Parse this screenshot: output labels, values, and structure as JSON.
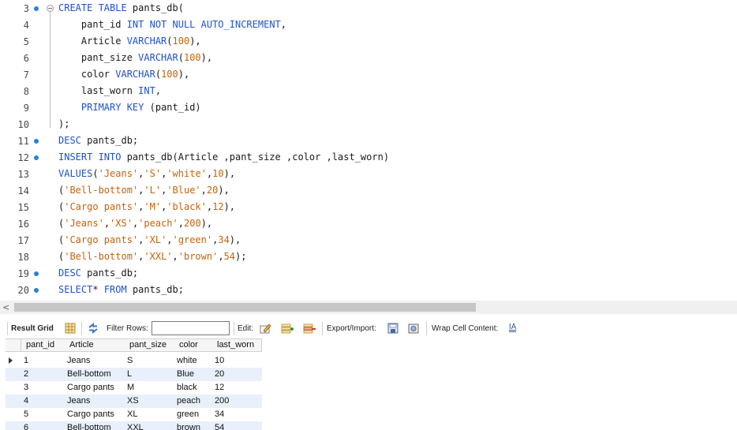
{
  "editor": {
    "lines": [
      {
        "num": "3",
        "marker": "fold",
        "tokens": [
          [
            "kw",
            "CREATE TABLE "
          ],
          [
            "t",
            "pants_db("
          ]
        ]
      },
      {
        "num": "4",
        "marker": "none",
        "tokens": [
          [
            "t",
            "    pant_id "
          ],
          [
            "kw",
            "INT NOT NULL AUTO_INCREMENT"
          ],
          [
            "t",
            ","
          ]
        ]
      },
      {
        "num": "5",
        "marker": "none",
        "tokens": [
          [
            "t",
            "    Article "
          ],
          [
            "kw",
            "VARCHAR"
          ],
          [
            "t",
            "("
          ],
          [
            "num",
            "100"
          ],
          [
            "t",
            "),"
          ]
        ]
      },
      {
        "num": "6",
        "marker": "none",
        "tokens": [
          [
            "t",
            "    pant_size "
          ],
          [
            "kw",
            "VARCHAR"
          ],
          [
            "t",
            "("
          ],
          [
            "num",
            "100"
          ],
          [
            "t",
            "),"
          ]
        ]
      },
      {
        "num": "7",
        "marker": "none",
        "tokens": [
          [
            "t",
            "    color "
          ],
          [
            "kw",
            "VARCHAR"
          ],
          [
            "t",
            "("
          ],
          [
            "num",
            "100"
          ],
          [
            "t",
            "),"
          ]
        ]
      },
      {
        "num": "8",
        "marker": "none",
        "tokens": [
          [
            "t",
            "    last_worn "
          ],
          [
            "kw",
            "INT"
          ],
          [
            "t",
            ","
          ]
        ]
      },
      {
        "num": "9",
        "marker": "none",
        "tokens": [
          [
            "t",
            "    "
          ],
          [
            "kw",
            "PRIMARY KEY"
          ],
          [
            "t",
            " (pant_id)"
          ]
        ]
      },
      {
        "num": "10",
        "marker": "none",
        "tokens": [
          [
            "t",
            ");"
          ]
        ]
      },
      {
        "num": "11",
        "marker": "dot",
        "tokens": [
          [
            "kw",
            "DESC"
          ],
          [
            "t",
            " pants_db;"
          ]
        ]
      },
      {
        "num": "12",
        "marker": "dot",
        "tokens": [
          [
            "kw",
            "INSERT INTO"
          ],
          [
            "t",
            " pants_db(Article ,pant_size ,color ,last_worn)"
          ]
        ]
      },
      {
        "num": "13",
        "marker": "none",
        "tokens": [
          [
            "kw",
            "VALUES"
          ],
          [
            "t",
            "("
          ],
          [
            "str",
            "'Jeans'"
          ],
          [
            "t",
            ","
          ],
          [
            "str",
            "'S'"
          ],
          [
            "t",
            ","
          ],
          [
            "str",
            "'white'"
          ],
          [
            "t",
            ","
          ],
          [
            "num",
            "10"
          ],
          [
            "t",
            "),"
          ]
        ]
      },
      {
        "num": "14",
        "marker": "none",
        "tokens": [
          [
            "t",
            "("
          ],
          [
            "str",
            "'Bell-bottom'"
          ],
          [
            "t",
            ","
          ],
          [
            "str",
            "'L'"
          ],
          [
            "t",
            ","
          ],
          [
            "str",
            "'Blue'"
          ],
          [
            "t",
            ","
          ],
          [
            "num",
            "20"
          ],
          [
            "t",
            "),"
          ]
        ]
      },
      {
        "num": "15",
        "marker": "none",
        "tokens": [
          [
            "t",
            "("
          ],
          [
            "str",
            "'Cargo pants'"
          ],
          [
            "t",
            ","
          ],
          [
            "str",
            "'M'"
          ],
          [
            "t",
            ","
          ],
          [
            "str",
            "'black'"
          ],
          [
            "t",
            ","
          ],
          [
            "num",
            "12"
          ],
          [
            "t",
            "),"
          ]
        ]
      },
      {
        "num": "16",
        "marker": "none",
        "tokens": [
          [
            "t",
            "("
          ],
          [
            "str",
            "'Jeans'"
          ],
          [
            "t",
            ","
          ],
          [
            "str",
            "'XS'"
          ],
          [
            "t",
            ","
          ],
          [
            "str",
            "'peach'"
          ],
          [
            "t",
            ","
          ],
          [
            "num",
            "200"
          ],
          [
            "t",
            "),"
          ]
        ]
      },
      {
        "num": "17",
        "marker": "none",
        "tokens": [
          [
            "t",
            "("
          ],
          [
            "str",
            "'Cargo pants'"
          ],
          [
            "t",
            ","
          ],
          [
            "str",
            "'XL'"
          ],
          [
            "t",
            ","
          ],
          [
            "str",
            "'green'"
          ],
          [
            "t",
            ","
          ],
          [
            "num",
            "34"
          ],
          [
            "t",
            "),"
          ]
        ]
      },
      {
        "num": "18",
        "marker": "none",
        "tokens": [
          [
            "t",
            "("
          ],
          [
            "str",
            "'Bell-bottom'"
          ],
          [
            "t",
            ","
          ],
          [
            "str",
            "'XXL'"
          ],
          [
            "t",
            ","
          ],
          [
            "str",
            "'brown'"
          ],
          [
            "t",
            ","
          ],
          [
            "num",
            "54"
          ],
          [
            "t",
            ");"
          ]
        ]
      },
      {
        "num": "19",
        "marker": "dot",
        "tokens": [
          [
            "kw",
            "DESC"
          ],
          [
            "t",
            " pants_db;"
          ]
        ]
      },
      {
        "num": "20",
        "marker": "dot",
        "tokens": [
          [
            "kw",
            "SELECT"
          ],
          [
            "t",
            "* "
          ],
          [
            "kw",
            "FROM"
          ],
          [
            "t",
            " pants_db;"
          ]
        ]
      }
    ]
  },
  "scrollbar": {
    "left_arrow": "<"
  },
  "toolbar": {
    "result_grid": "Result Grid",
    "filter_rows": "Filter Rows:",
    "filter_value": "",
    "edit": "Edit:",
    "export_import": "Export/Import:",
    "wrap_cell": "Wrap Cell Content:",
    "wrap_icon_text": "IA"
  },
  "grid": {
    "columns": [
      "pant_id",
      "Article",
      "pant_size",
      "color",
      "last_worn"
    ],
    "rows": [
      [
        "1",
        "Jeans",
        "S",
        "white",
        "10"
      ],
      [
        "2",
        "Bell-bottom",
        "L",
        "Blue",
        "20"
      ],
      [
        "3",
        "Cargo pants",
        "M",
        "black",
        "12"
      ],
      [
        "4",
        "Jeans",
        "XS",
        "peach",
        "200"
      ],
      [
        "5",
        "Cargo pants",
        "XL",
        "green",
        "34"
      ],
      [
        "6",
        "Bell-bottom",
        "XXL",
        "brown",
        "54"
      ]
    ]
  },
  "colors": {
    "keyword": "#1f52c8",
    "literal": "#c8620a",
    "row_alt": "#e9f0fb"
  }
}
